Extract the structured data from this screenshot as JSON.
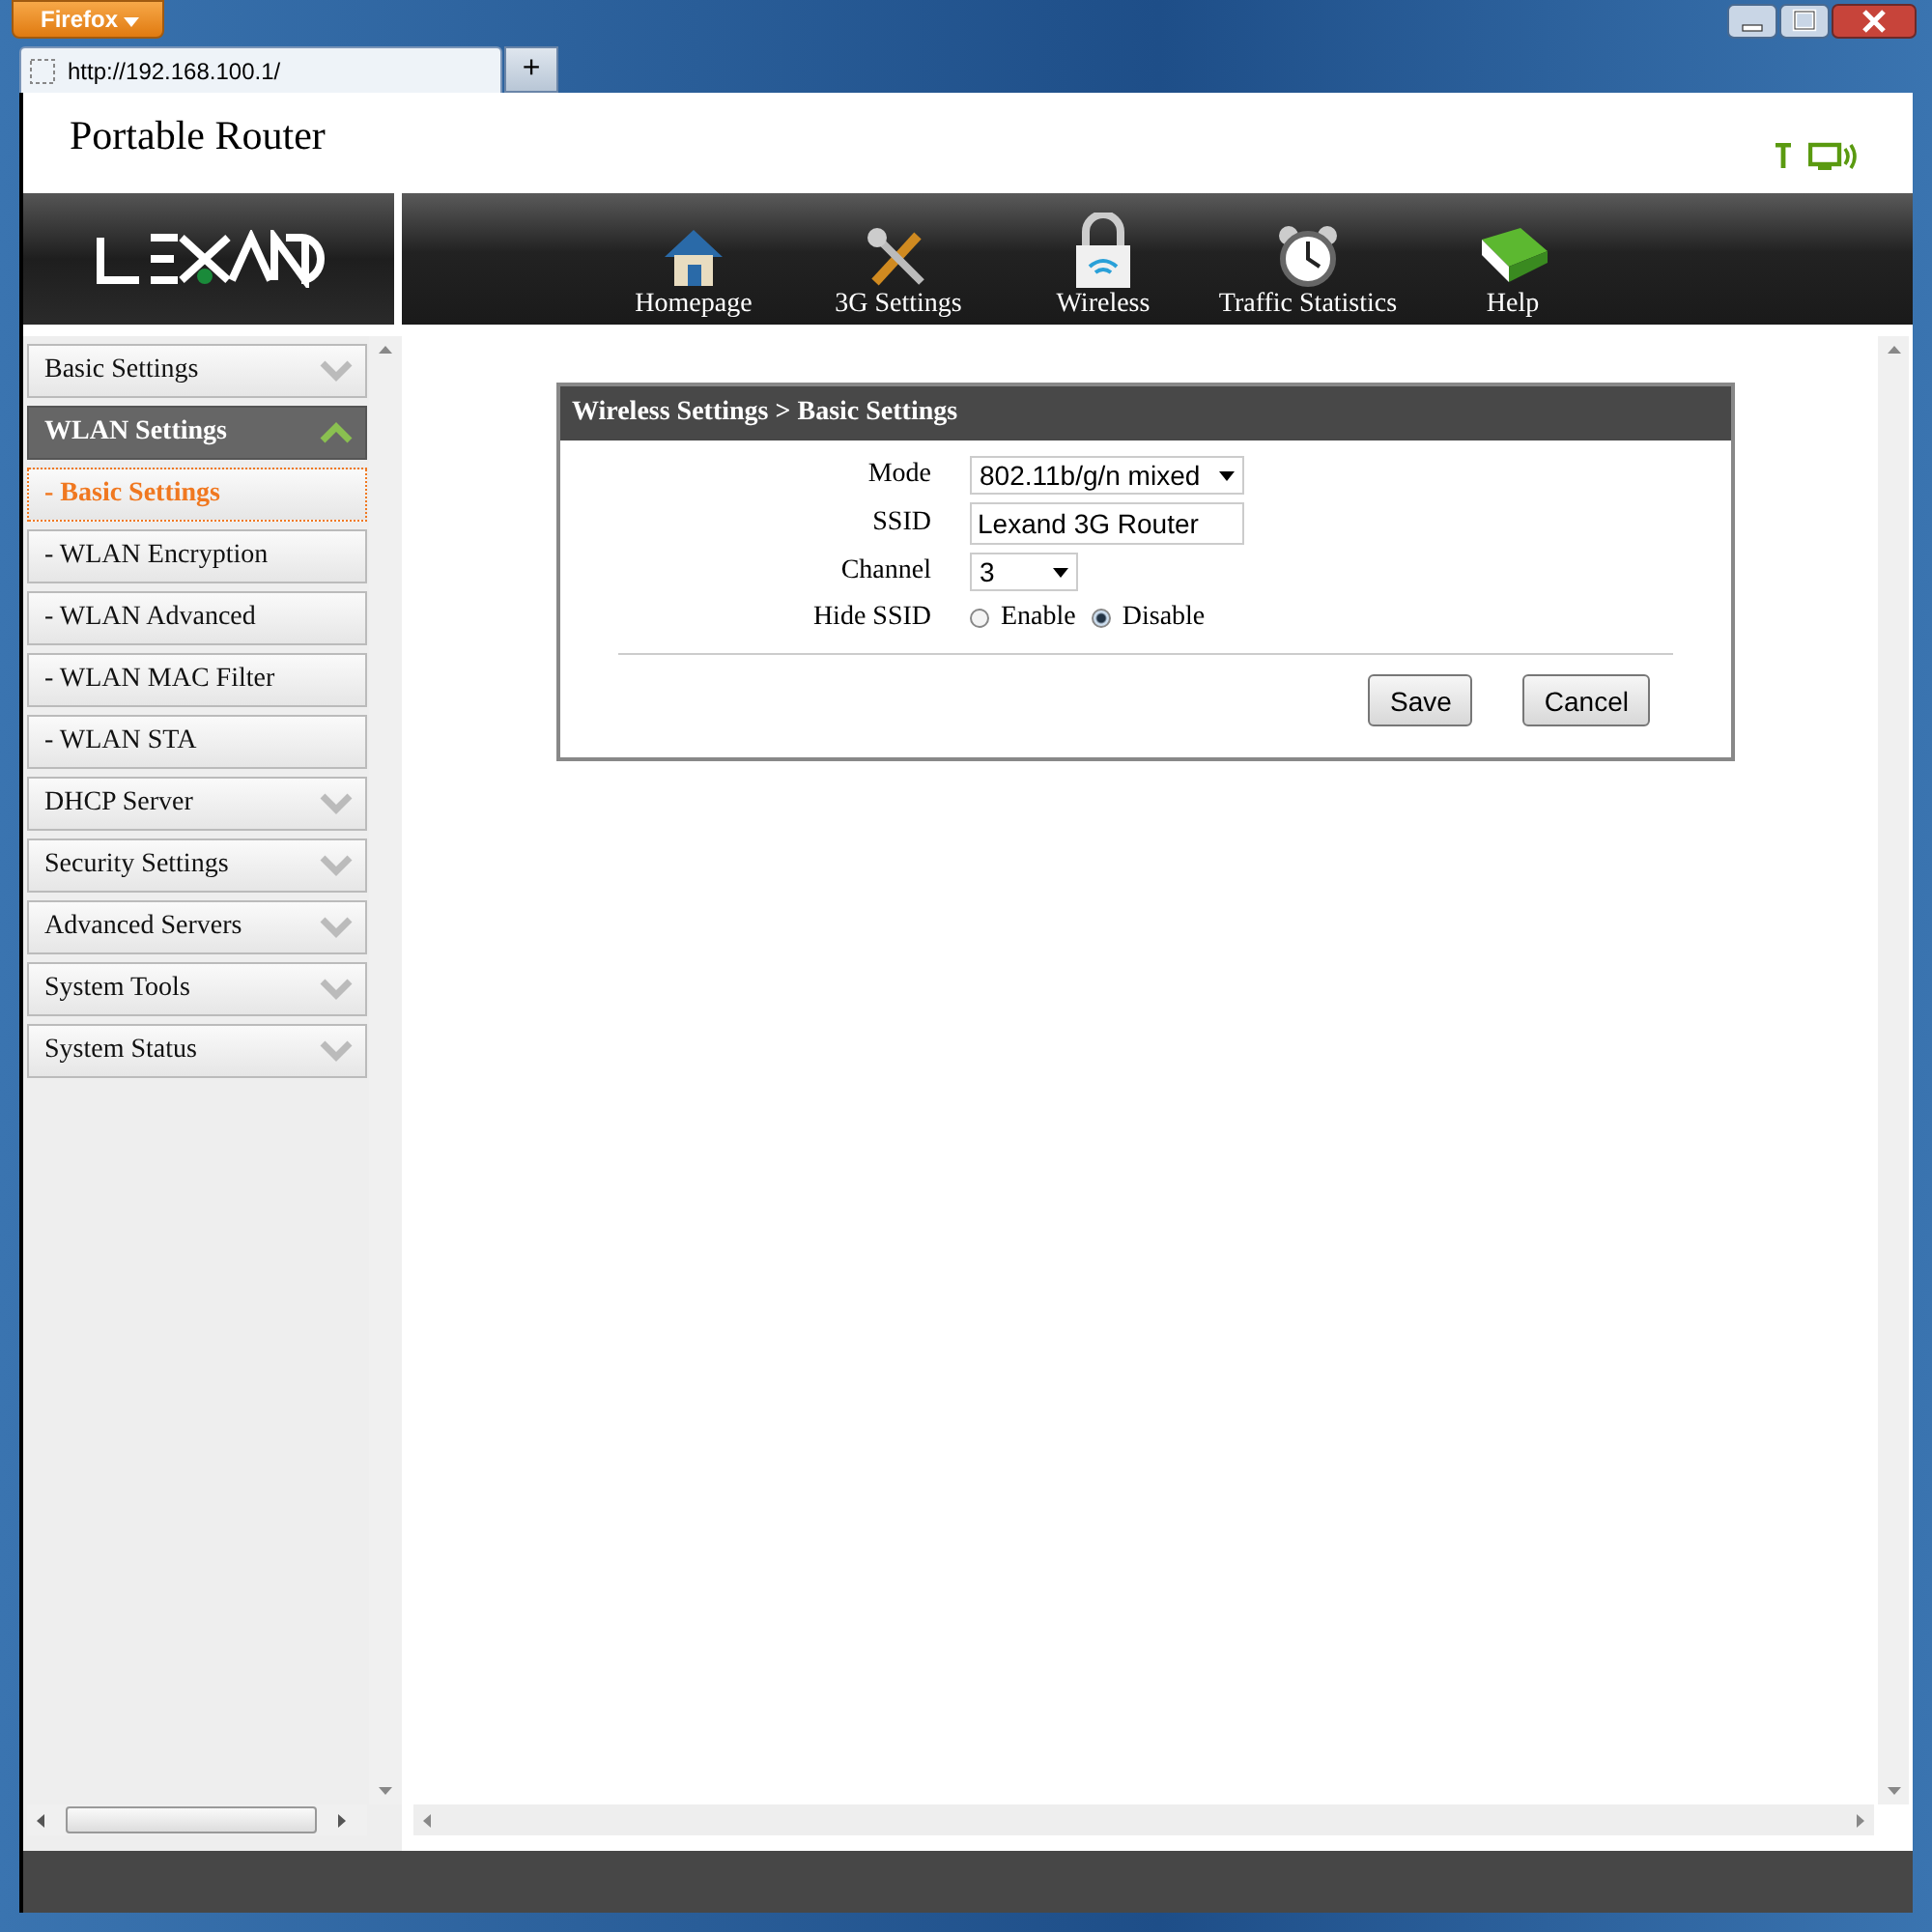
{
  "browser": {
    "menu_button": "Firefox",
    "tab": {
      "title": "http://192.168.100.1/"
    },
    "new_tab": "+"
  },
  "header": {
    "title": "Portable Router"
  },
  "nav": [
    {
      "label": "Homepage",
      "kind": "home"
    },
    {
      "label": "3G Settings",
      "kind": "tools"
    },
    {
      "label": "Wireless",
      "kind": "lock"
    },
    {
      "label": "Traffic Statistics",
      "kind": "clock"
    },
    {
      "label": "Help",
      "kind": "book"
    }
  ],
  "sidebar": {
    "items": [
      {
        "label": "Basic Settings",
        "kind": "group",
        "expanded": false
      },
      {
        "label": "WLAN Settings",
        "kind": "group",
        "expanded": true
      },
      {
        "label": "- Basic Settings",
        "kind": "sub",
        "selected": true
      },
      {
        "label": "- WLAN Encryption",
        "kind": "sub",
        "selected": false
      },
      {
        "label": "- WLAN Advanced",
        "kind": "sub",
        "selected": false
      },
      {
        "label": "- WLAN MAC Filter",
        "kind": "sub",
        "selected": false
      },
      {
        "label": "- WLAN STA",
        "kind": "sub",
        "selected": false
      },
      {
        "label": "DHCP Server",
        "kind": "group",
        "expanded": false
      },
      {
        "label": "Security Settings",
        "kind": "group",
        "expanded": false
      },
      {
        "label": "Advanced Servers",
        "kind": "group",
        "expanded": false
      },
      {
        "label": "System Tools",
        "kind": "group",
        "expanded": false
      },
      {
        "label": "System Status",
        "kind": "group",
        "expanded": false
      }
    ]
  },
  "panel": {
    "title": "Wireless Settings > Basic Settings",
    "fields": [
      {
        "label": "Mode",
        "kind": "select",
        "value": "802.11b/g/n mixed"
      },
      {
        "label": "SSID",
        "kind": "text",
        "value": "Lexand 3G Router"
      },
      {
        "label": "Channel",
        "kind": "select",
        "value": "3"
      },
      {
        "label": "Hide SSID",
        "kind": "radio",
        "options": [
          {
            "label": "Enable",
            "selected": false
          },
          {
            "label": "Disable",
            "selected": true
          }
        ]
      }
    ],
    "buttons": [
      "Save",
      "Cancel"
    ]
  }
}
